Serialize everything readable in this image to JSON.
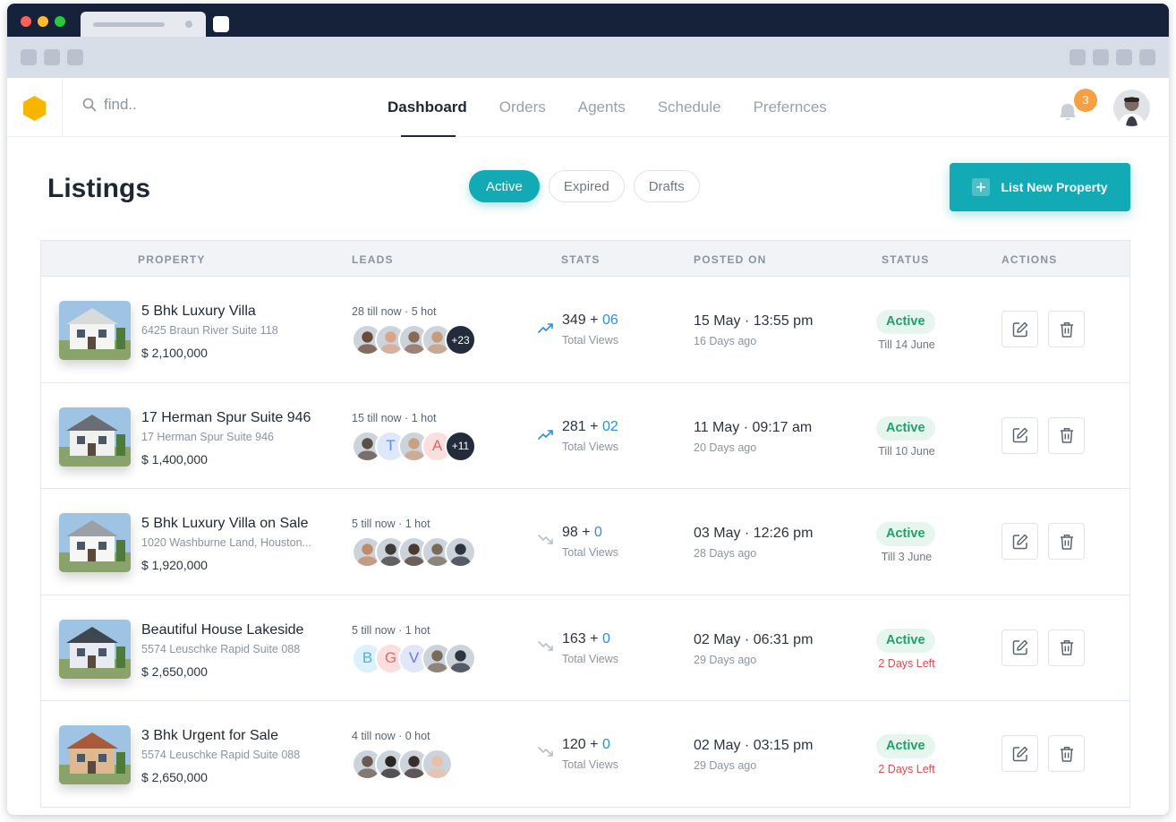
{
  "nav": {
    "search_placeholder": "find..",
    "menu": [
      {
        "label": "Dashboard",
        "active": true
      },
      {
        "label": "Orders",
        "active": false
      },
      {
        "label": "Agents",
        "active": false
      },
      {
        "label": "Schedule",
        "active": false
      },
      {
        "label": "Prefernces",
        "active": false
      }
    ],
    "notification_count": "3"
  },
  "header": {
    "title": "Listings",
    "filters": [
      "Active",
      "Expired",
      "Drafts"
    ],
    "active_filter": "Active",
    "primary_button": "List New Property"
  },
  "table": {
    "columns": [
      "PROPERTY",
      "LEADS",
      "STATS",
      "POSTED ON",
      "STATUS",
      "ACTIONS"
    ],
    "rows": [
      {
        "name": "5 Bhk Luxury Villa",
        "address": "6425 Braun River Suite 118",
        "price": "$ 2,100,000",
        "leads_text": "28 till now · 5 hot",
        "avatars": [
          {
            "type": "photo",
            "color": "#6b4a3a"
          },
          {
            "type": "photo",
            "color": "#d9a58a"
          },
          {
            "type": "photo",
            "color": "#8a6a55"
          },
          {
            "type": "photo",
            "color": "#c79a7a"
          }
        ],
        "more": "+23",
        "trend": "up",
        "views": "349",
        "views_plus": "06",
        "views_label": "Total Views",
        "posted": "15 May · 13:55 pm",
        "ago": "16 Days ago",
        "status": "Active",
        "till": "Till 14 June",
        "till_warn": false
      },
      {
        "name": "17 Herman Spur Suite 946",
        "address": "17 Herman Spur Suite 946",
        "price": "$ 1,400,000",
        "leads_text": "15 till now · 1 hot",
        "avatars": [
          {
            "type": "photo",
            "color": "#5b4e45"
          },
          {
            "type": "letter",
            "letter": "T",
            "bg": "#dde8fb",
            "fg": "#5b8fe0"
          },
          {
            "type": "photo",
            "color": "#c9a080"
          },
          {
            "type": "letter",
            "letter": "A",
            "bg": "#fbdede",
            "fg": "#e06a6a"
          }
        ],
        "more": "+11",
        "trend": "up",
        "views": "281",
        "views_plus": "02",
        "views_label": "Total Views",
        "posted": "11 May · 09:17 am",
        "ago": "20 Days ago",
        "status": "Active",
        "till": "Till 10 June",
        "till_warn": false
      },
      {
        "name": "5 Bhk Luxury Villa on Sale",
        "address": "1020 Washburne Land, Houston...",
        "price": "$ 1,920,000",
        "leads_text": "5 till now · 1 hot",
        "avatars": [
          {
            "type": "photo",
            "color": "#c08a6a"
          },
          {
            "type": "photo",
            "color": "#3e3a38"
          },
          {
            "type": "photo",
            "color": "#4a3a30"
          },
          {
            "type": "photo",
            "color": "#7a6a5a"
          },
          {
            "type": "photo",
            "color": "#2e3440"
          }
        ],
        "more": "",
        "trend": "down",
        "views": "98",
        "views_plus": "0",
        "views_label": "Total Views",
        "posted": "03 May · 12:26 pm",
        "ago": "28 Days ago",
        "status": "Active",
        "till": "Till 3 June",
        "till_warn": false
      },
      {
        "name": "Beautiful House Lakeside",
        "address": "5574 Leuschke Rapid Suite 088",
        "price": "$ 2,650,000",
        "leads_text": "5 till now · 1 hot",
        "avatars": [
          {
            "type": "letter",
            "letter": "B",
            "bg": "#ddf1fb",
            "fg": "#4ab3de"
          },
          {
            "type": "letter",
            "letter": "G",
            "bg": "#fbdede",
            "fg": "#e06a6a"
          },
          {
            "type": "letter",
            "letter": "V",
            "bg": "#e2e6fb",
            "fg": "#6a7ae0"
          },
          {
            "type": "photo",
            "color": "#7a6a5a"
          },
          {
            "type": "photo",
            "color": "#2e3440"
          }
        ],
        "more": "",
        "trend": "down",
        "views": "163",
        "views_plus": "0",
        "views_label": "Total Views",
        "posted": "02 May · 06:31 pm",
        "ago": "29 Days ago",
        "status": "Active",
        "till": "2 Days Left",
        "till_warn": true
      },
      {
        "name": "3 Bhk Urgent for Sale",
        "address": "5574 Leuschke Rapid Suite 088",
        "price": "$ 2,650,000",
        "leads_text": "4 till now · 0 hot",
        "avatars": [
          {
            "type": "photo",
            "color": "#6a5a52"
          },
          {
            "type": "photo",
            "color": "#2a2624"
          },
          {
            "type": "photo",
            "color": "#3a2e2a"
          },
          {
            "type": "photo",
            "color": "#e8c0a8"
          }
        ],
        "more": "",
        "trend": "down",
        "views": "120",
        "views_plus": "0",
        "views_label": "Total Views",
        "posted": "02 May · 03:15 pm",
        "ago": "29 Days ago",
        "status": "Active",
        "till": "2 Days Left",
        "till_warn": true
      }
    ]
  },
  "colors": {
    "accent": "#12aab5",
    "badge": "#f5a044",
    "status_bg": "#e6f6ef",
    "status_fg": "#22a06b",
    "warn": "#e5484d",
    "logo": "#f7b500"
  }
}
